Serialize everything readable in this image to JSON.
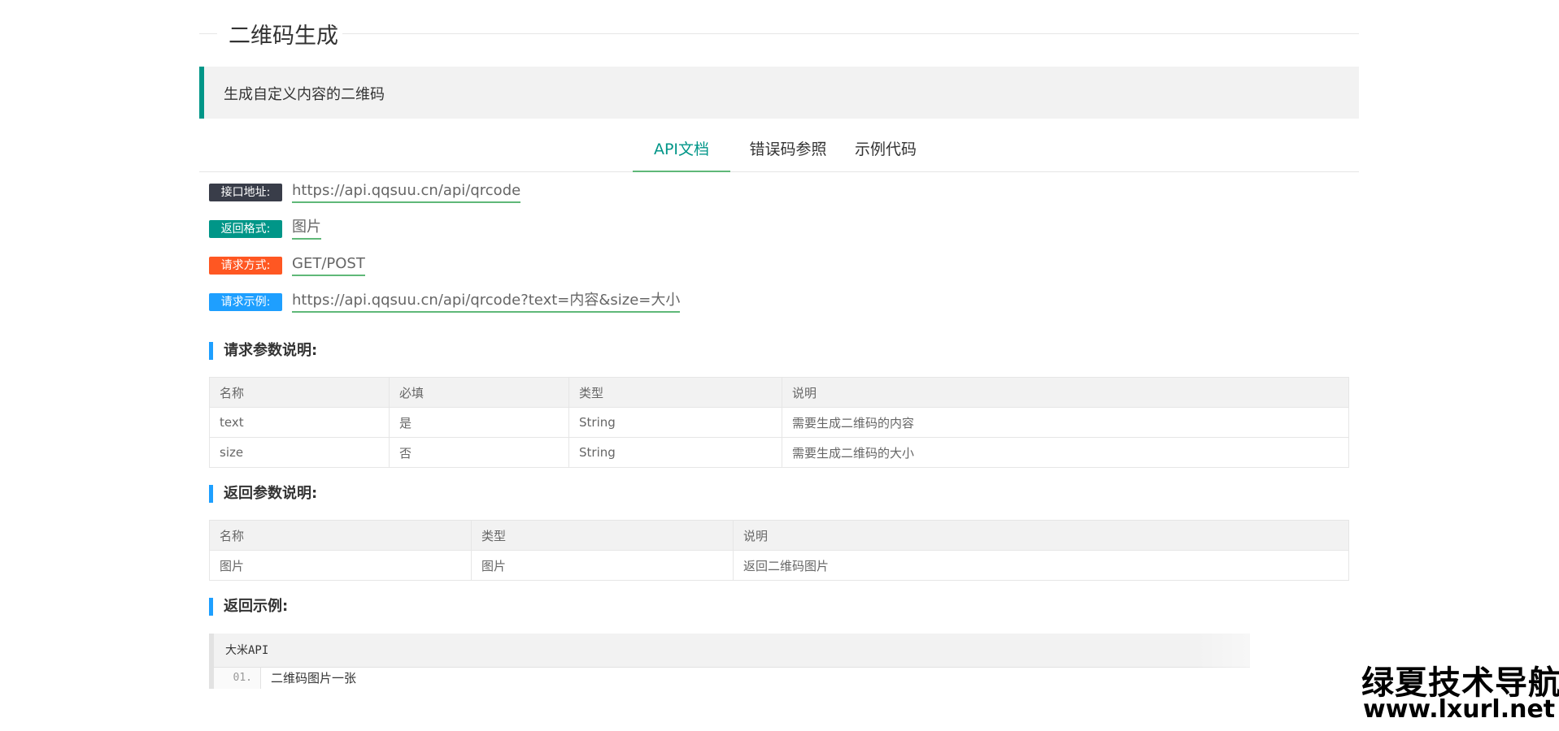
{
  "page": {
    "title": "二维码生成",
    "description": "生成自定义内容的二维码"
  },
  "tabs": [
    {
      "label": "API文档",
      "active": true
    },
    {
      "label": "错误码参照",
      "active": false
    },
    {
      "label": "示例代码",
      "active": false
    }
  ],
  "info": {
    "endpoint": {
      "label": "接口地址:",
      "value": "https://api.qqsuu.cn/api/qrcode",
      "color": "#393d49"
    },
    "format": {
      "label": "返回格式:",
      "value": "图片",
      "color": "#009688"
    },
    "method": {
      "label": "请求方式:",
      "value": "GET/POST",
      "color": "#ff5722"
    },
    "example": {
      "label": "请求示例:",
      "value": "https://api.qqsuu.cn/api/qrcode?text=内容&size=大小",
      "color": "#1e9fff"
    }
  },
  "request_params": {
    "heading": "请求参数说明:",
    "columns": [
      "名称",
      "必填",
      "类型",
      "说明"
    ],
    "rows": [
      [
        "text",
        "是",
        "String",
        "需要生成二维码的内容"
      ],
      [
        "size",
        "否",
        "String",
        "需要生成二维码的大小"
      ]
    ]
  },
  "response_params": {
    "heading": "返回参数说明:",
    "columns": [
      "名称",
      "类型",
      "说明"
    ],
    "rows": [
      [
        "图片",
        "图片",
        "返回二维码图片"
      ]
    ]
  },
  "response_example": {
    "heading": "返回示例:",
    "code_title": "大米API",
    "lines": [
      {
        "num": "01.",
        "text": "二维码图片一张"
      }
    ]
  },
  "watermark": {
    "line1": "绿夏技术导航",
    "line2": "www.lxurl.net"
  },
  "colors": {
    "accent": "#009688",
    "tab_underline": "#5fb878",
    "section_bar": "#1e9fff"
  }
}
